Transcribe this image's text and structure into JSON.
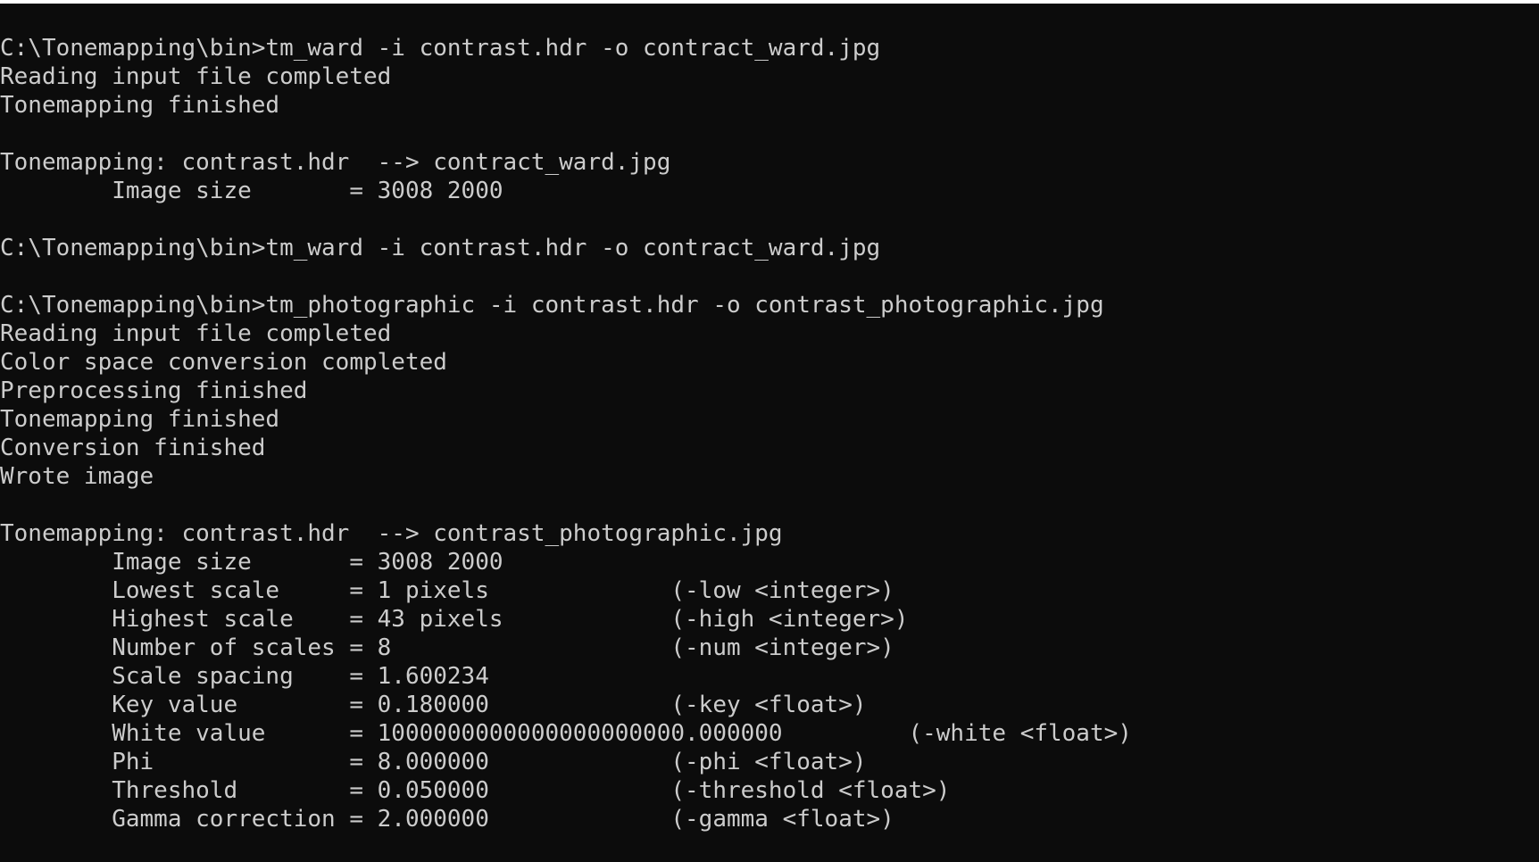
{
  "console": {
    "lines": [
      "C:\\Tonemapping\\bin>tm_ward -i contrast.hdr -o contract_ward.jpg",
      "Reading input file completed",
      "Tonemapping finished",
      "",
      "Tonemapping: contrast.hdr  --> contract_ward.jpg",
      "        Image size       = 3008 2000",
      "",
      "C:\\Tonemapping\\bin>tm_ward -i contrast.hdr -o contract_ward.jpg",
      "",
      "C:\\Tonemapping\\bin>tm_photographic -i contrast.hdr -o contrast_photographic.jpg",
      "Reading input file completed",
      "Color space conversion completed",
      "Preprocessing finished",
      "Tonemapping finished",
      "Conversion finished",
      "Wrote image",
      "",
      "Tonemapping: contrast.hdr  --> contrast_photographic.jpg",
      "        Image size       = 3008 2000",
      "        Lowest scale     = 1 pixels             (-low <integer>)",
      "        Highest scale    = 43 pixels            (-high <integer>)",
      "        Number of scales = 8                    (-num <integer>)",
      "        Scale spacing    = 1.600234",
      "        Key value        = 0.180000             (-key <float>)",
      "        White value      = 1000000000000000000000.000000         (-white <float>)",
      "        Phi              = 8.000000             (-phi <float>)",
      "        Threshold        = 0.050000             (-threshold <float>)",
      "        Gamma correction = 2.000000             (-gamma <float>)"
    ]
  }
}
